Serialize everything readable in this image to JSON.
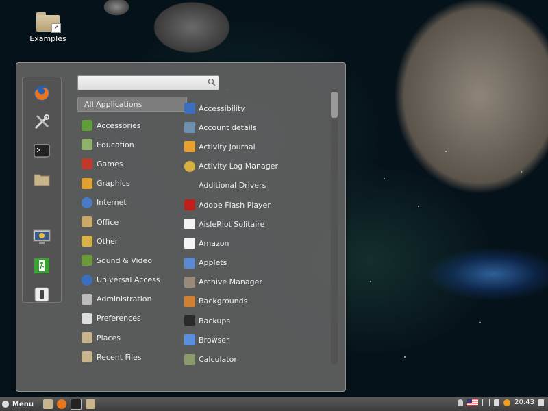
{
  "desktop": {
    "icon_label": "Examples"
  },
  "search": {
    "value": "",
    "placeholder": ""
  },
  "favorites": [
    {
      "name": "firefox-icon"
    },
    {
      "name": "settings-tools-icon"
    },
    {
      "name": "terminal-icon"
    },
    {
      "name": "files-folder-icon"
    },
    {
      "name": "lock-screen-icon"
    },
    {
      "name": "logout-icon"
    },
    {
      "name": "shutdown-icon"
    }
  ],
  "categories": [
    {
      "label": "All Applications",
      "icon": "",
      "color": ""
    },
    {
      "label": "Accessories",
      "icon": "accessories-icon",
      "color": "#5f9e3a"
    },
    {
      "label": "Education",
      "icon": "education-icon",
      "color": "#8fb26b"
    },
    {
      "label": "Games",
      "icon": "games-icon",
      "color": "#c0392b"
    },
    {
      "label": "Graphics",
      "icon": "graphics-icon",
      "color": "#e0a030"
    },
    {
      "label": "Internet",
      "icon": "internet-icon",
      "color": "#4a7bc8"
    },
    {
      "label": "Office",
      "icon": "office-icon",
      "color": "#c9a86a"
    },
    {
      "label": "Other",
      "icon": "other-icon",
      "color": "#d8b24a"
    },
    {
      "label": "Sound & Video",
      "icon": "sound-video-icon",
      "color": "#6a9a3a"
    },
    {
      "label": "Universal Access",
      "icon": "universal-access-icon",
      "color": "#3a6fc0"
    },
    {
      "label": "Administration",
      "icon": "administration-icon",
      "color": "#bbbbbb"
    },
    {
      "label": "Preferences",
      "icon": "preferences-icon",
      "color": "#dddddd"
    },
    {
      "label": "Places",
      "icon": "places-folder-icon",
      "color": "#c8b48c"
    },
    {
      "label": "Recent Files",
      "icon": "recent-files-folder-icon",
      "color": "#c8b48c"
    }
  ],
  "apps": [
    {
      "label": "Accessibility",
      "icon": "accessibility-icon",
      "color": "#3a6fc0"
    },
    {
      "label": "Account details",
      "icon": "account-details-icon",
      "color": "#6f8fb0"
    },
    {
      "label": "Activity Journal",
      "icon": "activity-journal-icon",
      "color": "#e8a030"
    },
    {
      "label": "Activity Log Manager",
      "icon": "activity-log-manager-icon",
      "color": "#d8b040"
    },
    {
      "label": "Additional Drivers",
      "icon": "",
      "color": ""
    },
    {
      "label": "Adobe Flash Player",
      "icon": "flash-player-icon",
      "color": "#c0201a"
    },
    {
      "label": "AisleRiot Solitaire",
      "icon": "solitaire-icon",
      "color": "#f2f2f2"
    },
    {
      "label": "Amazon",
      "icon": "amazon-icon",
      "color": "#f5f5f5"
    },
    {
      "label": "Applets",
      "icon": "applets-icon",
      "color": "#5a8ad0"
    },
    {
      "label": "Archive Manager",
      "icon": "archive-manager-icon",
      "color": "#9a8a7a"
    },
    {
      "label": "Backgrounds",
      "icon": "backgrounds-icon",
      "color": "#d08030"
    },
    {
      "label": "Backups",
      "icon": "backups-icon",
      "color": "#2a2a2a"
    },
    {
      "label": "Browser",
      "icon": "browser-icon",
      "color": "#5a8ee0"
    },
    {
      "label": "Calculator",
      "icon": "calculator-icon",
      "color": "#8a9a6a"
    }
  ],
  "taskbar": {
    "menu_label": "Menu",
    "clock": "20:43"
  }
}
